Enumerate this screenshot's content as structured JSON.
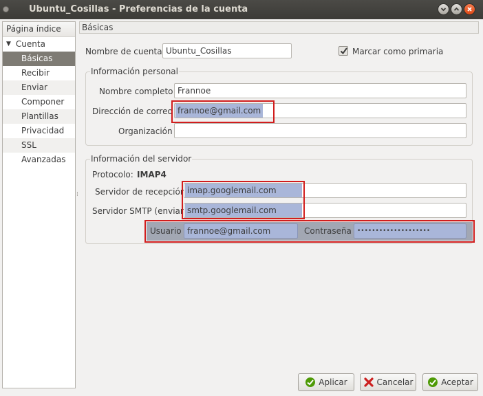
{
  "window": {
    "title": "Ubuntu_Cosillas - Preferencias de la cuenta"
  },
  "sidebar": {
    "header": "Página índice",
    "parent": "Cuenta",
    "items": [
      {
        "label": "Básicas",
        "selected": true
      },
      {
        "label": "Recibir"
      },
      {
        "label": "Enviar"
      },
      {
        "label": "Componer"
      },
      {
        "label": "Plantillas"
      },
      {
        "label": "Privacidad"
      },
      {
        "label": "SSL"
      },
      {
        "label": "Avanzadas"
      }
    ]
  },
  "page": {
    "title": "Básicas"
  },
  "account": {
    "name_label": "Nombre de cuenta",
    "name_value": "Ubuntu_Cosillas",
    "primary_label": "Marcar como primaria",
    "primary_checked": true
  },
  "personal": {
    "title": "Información personal",
    "fullname_label": "Nombre completo",
    "fullname_value": "Frannoe",
    "email_label": "Dirección de correo",
    "email_value": "frannoe@gmail.com",
    "org_label": "Organización",
    "org_value": ""
  },
  "server": {
    "title": "Información del servidor",
    "protocol_label": "Protocolo:",
    "protocol_value": "IMAP4",
    "incoming_label": "Servidor de recepción",
    "incoming_value": "imap.googlemail.com",
    "smtp_label": "Servidor SMTP (enviar)",
    "smtp_value": "smtp.googlemail.com",
    "user_label": "Usuario",
    "user_value": "frannoe@gmail.com",
    "password_label": "Contraseña",
    "password_value": "••••••••••••••••••••"
  },
  "buttons": {
    "apply": "Aplicar",
    "cancel": "Cancelar",
    "accept": "Aceptar"
  },
  "colors": {
    "highlight_field": "#a9b6d9",
    "annotation_red": "#d11d1d",
    "selected_row": "#7e7b74"
  }
}
